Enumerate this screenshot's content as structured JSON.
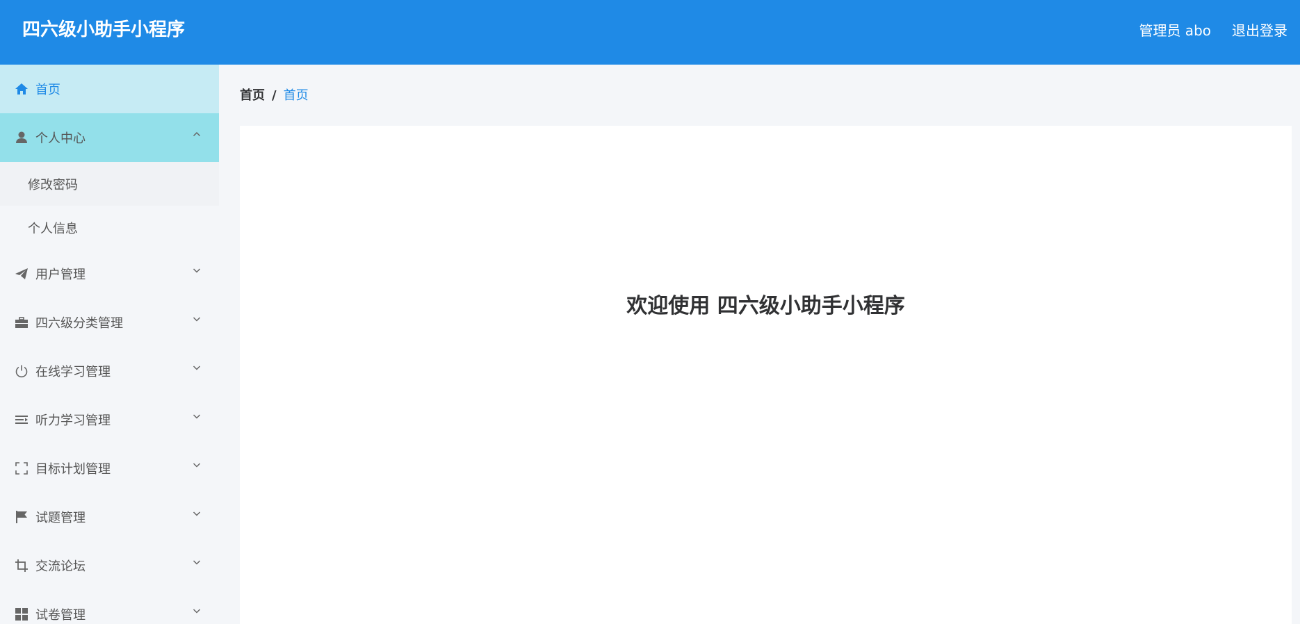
{
  "header": {
    "app_title": "四六级小助手小程序",
    "user_name": "管理员 abo",
    "logout_label": "退出登录",
    "background_color": "#1f8ae6"
  },
  "sidebar": {
    "items": [
      {
        "label": "首页",
        "icon": "home-icon",
        "state": "active"
      },
      {
        "label": "个人中心",
        "icon": "user-icon",
        "state": "expanded",
        "children": [
          {
            "label": "修改密码"
          },
          {
            "label": "个人信息"
          }
        ]
      },
      {
        "label": "用户管理",
        "icon": "paper-plane-icon",
        "state": "collapsed"
      },
      {
        "label": "四六级分类管理",
        "icon": "briefcase-icon",
        "state": "collapsed"
      },
      {
        "label": "在线学习管理",
        "icon": "power-icon",
        "state": "collapsed"
      },
      {
        "label": "听力学习管理",
        "icon": "indent-list-icon",
        "state": "collapsed"
      },
      {
        "label": "目标计划管理",
        "icon": "fullscreen-icon",
        "state": "collapsed"
      },
      {
        "label": "试题管理",
        "icon": "flag-icon",
        "state": "collapsed"
      },
      {
        "label": "交流论坛",
        "icon": "crop-icon",
        "state": "collapsed"
      },
      {
        "label": "试卷管理",
        "icon": "grid-icon",
        "state": "collapsed"
      }
    ],
    "active_color": "#1f8ae6",
    "active_background": "#c6ebf4",
    "expanded_background": "#93e0ea"
  },
  "breadcrumb": {
    "root": "首页",
    "separator": "/",
    "current": "首页"
  },
  "main": {
    "welcome_text": "欢迎使用 四六级小助手小程序"
  }
}
